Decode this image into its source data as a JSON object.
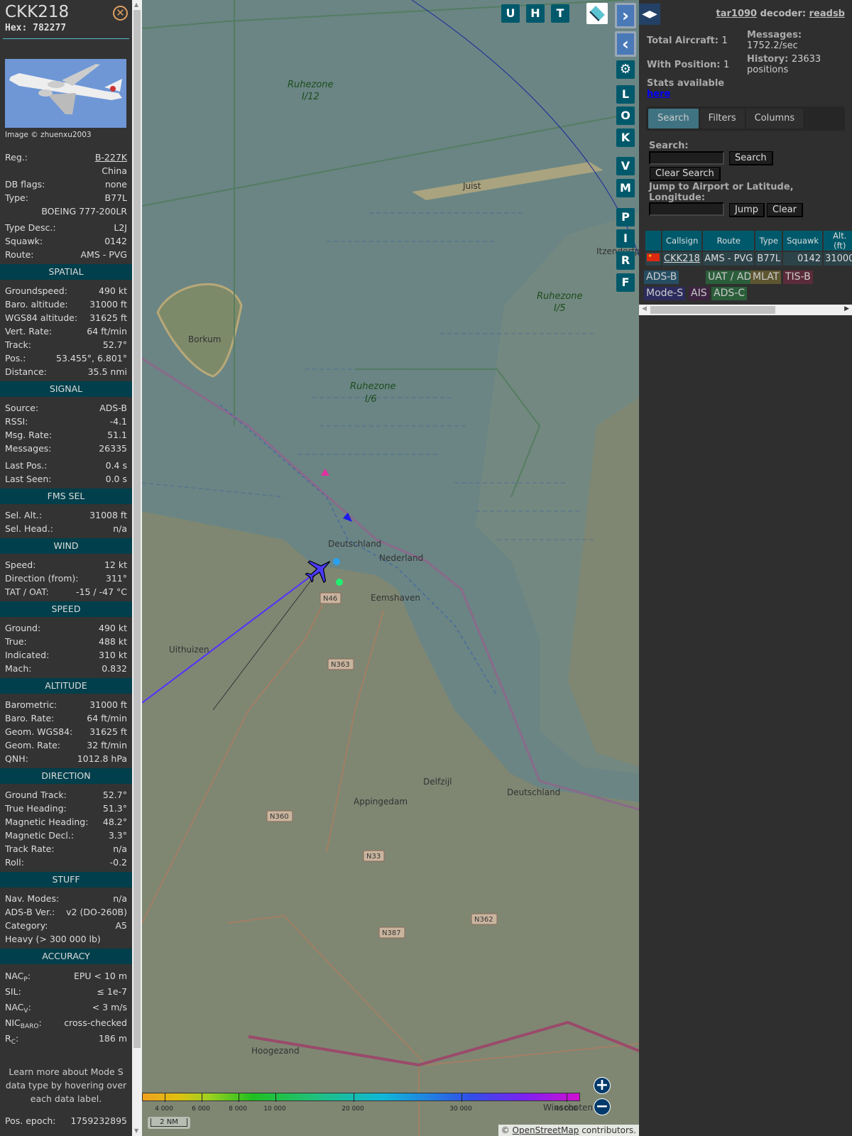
{
  "aircraft": {
    "callsign": "CKK218",
    "hex": "Hex: 782277",
    "image_credit": "Image © zhuenxu2003"
  },
  "info": [
    {
      "label": "Reg.:",
      "value": "B-227K",
      "link": true
    },
    {
      "label": "",
      "value": "China"
    },
    {
      "label": "DB flags:",
      "value": "none"
    },
    {
      "label": "Type:",
      "value": "B77L"
    },
    {
      "label": "",
      "value": "BOEING 777-200LR"
    },
    {
      "label": "Type Desc.:",
      "value": "L2J"
    },
    {
      "label": "Squawk:",
      "value": "0142"
    },
    {
      "label": "Route:",
      "value": "AMS - PVG"
    }
  ],
  "sections": [
    {
      "title": "SPATIAL",
      "rows": [
        [
          "Groundspeed:",
          "490 kt"
        ],
        [
          "Baro. altitude:",
          "31000 ft"
        ],
        [
          "WGS84 altitude:",
          "31625 ft"
        ],
        [
          "Vert. Rate:",
          "64 ft/min"
        ],
        [
          "Track:",
          "52.7°"
        ],
        [
          "Pos.:",
          "53.455°, 6.801°"
        ],
        [
          "Distance:",
          "35.5 nmi"
        ]
      ]
    },
    {
      "title": "SIGNAL",
      "rows": [
        [
          "Source:",
          "ADS-B"
        ],
        [
          "RSSI:",
          "-4.1"
        ],
        [
          "Msg. Rate:",
          "51.1"
        ],
        [
          "Messages:",
          "26335"
        ],
        [
          "Last Pos.:",
          "0.4 s"
        ],
        [
          "Last Seen:",
          "0.0 s"
        ]
      ]
    },
    {
      "title": "FMS SEL",
      "rows": [
        [
          "Sel. Alt.:",
          "31008 ft"
        ],
        [
          "Sel. Head.:",
          "n/a"
        ]
      ]
    },
    {
      "title": "WIND",
      "rows": [
        [
          "Speed:",
          "12 kt"
        ],
        [
          "Direction (from):",
          "311°"
        ],
        [
          "TAT / OAT:",
          "-15 / -47 °C"
        ]
      ]
    },
    {
      "title": "SPEED",
      "rows": [
        [
          "Ground:",
          "490 kt"
        ],
        [
          "True:",
          "488 kt"
        ],
        [
          "Indicated:",
          "310 kt"
        ],
        [
          "Mach:",
          "0.832"
        ]
      ]
    },
    {
      "title": "ALTITUDE",
      "rows": [
        [
          "Barometric:",
          "31000 ft"
        ],
        [
          "Baro. Rate:",
          "64 ft/min"
        ],
        [
          "Geom. WGS84:",
          "31625 ft"
        ],
        [
          "Geom. Rate:",
          "32 ft/min"
        ],
        [
          "QNH:",
          "1012.8 hPa"
        ]
      ]
    },
    {
      "title": "DIRECTION",
      "rows": [
        [
          "Ground Track:",
          "52.7°"
        ],
        [
          "True Heading:",
          "51.3°"
        ],
        [
          "Magnetic Heading:",
          "48.2°"
        ],
        [
          "Magnetic Decl.:",
          "3.3°"
        ],
        [
          "Track Rate:",
          "n/a"
        ],
        [
          "Roll:",
          "-0.2"
        ]
      ]
    },
    {
      "title": "STUFF",
      "rows": [
        [
          "Nav. Modes:",
          "n/a"
        ],
        [
          "ADS-B Ver.:",
          "v2 (DO-260B)"
        ],
        [
          "Category:",
          "A5"
        ]
      ],
      "extra": "Heavy (> 300 000 lb)"
    }
  ],
  "accuracy": {
    "title": "ACCURACY",
    "rows": [
      {
        "label": "NAC",
        "sub": "P",
        "value": "EPU < 10 m"
      },
      {
        "label": "SIL",
        "sub": "",
        "value": "≤ 1e-7"
      },
      {
        "label": "NAC",
        "sub": "V",
        "value": "< 3 m/s"
      },
      {
        "label": "NIC",
        "sub": "BARO",
        "value": "cross-checked"
      },
      {
        "label": "R",
        "sub": "C",
        "value": "186 m"
      }
    ],
    "note": "Learn more about Mode S data type by hovering over each data label.",
    "epoch_label": "Pos. epoch:",
    "epoch_value": "1759232895"
  },
  "map": {
    "buttons_top": [
      "U",
      "H",
      "T"
    ],
    "buttons_side": [
      "L",
      "O",
      "K",
      "V",
      "M",
      "P",
      "I",
      "R",
      "F"
    ],
    "labels": {
      "rz12a": "Ruhezone",
      "rz12b": "I/12",
      "rz6a": "Ruhezone",
      "rz6b": "I/6",
      "rz5a": "Ruhezone",
      "rz5b": "I/5",
      "borkum": "Borkum",
      "juist": "Juist",
      "uithuizen": "Uithuizen",
      "eemshaven": "Eemshaven",
      "delfzijl": "Delfzijl",
      "appingedam": "Appingedam",
      "hoogezand": "Hoogezand",
      "winschoten": "Winschoten",
      "de": "Deutschland",
      "nl": "Nederland",
      "de2": "Deutschland",
      "itzendorf": "Itzendorfplate",
      "n46": "N46",
      "n363": "N363",
      "n360": "N360",
      "n33": "N33",
      "n362": "N362",
      "n387": "N387"
    },
    "legend_labels": [
      "4 000",
      "6 000",
      "8 000",
      "10 000",
      "20 000",
      "30 000",
      "40 000"
    ],
    "scale": "2 NM",
    "attribution_prefix": "© ",
    "attribution_link": "OpenStreetMap",
    "attribution_suffix": " contributors.",
    "zoom_in": "+",
    "zoom_out": "−"
  },
  "right": {
    "toggle": "◀▶",
    "decoder_name": "tar1090",
    "decoder_mid": " decoder: ",
    "decoder_impl": "readsb",
    "total_label": "Total Aircraft:",
    "total": "1",
    "withpos_label": "With Position:",
    "withpos": "1",
    "messages_label": "Messages:",
    "messages": "1752.2/sec",
    "history_label": "History:",
    "history": "23633 positions",
    "stats_label": "Stats available",
    "stats_link": "here",
    "tabs": [
      "Search",
      "Filters",
      "Columns"
    ],
    "search_label": "Search:",
    "search_value": "",
    "search_btn": "Search",
    "clear_search_btn": "Clear Search",
    "jump_label": "Jump to Airport or Latitude, Longitude:",
    "jump_value": "",
    "jump_btn": "Jump",
    "clear_btn": "Clear",
    "table": {
      "headers": [
        "",
        "Callsign",
        "Route",
        "Type",
        "Squawk",
        "Alt. (ft)"
      ],
      "rows": [
        {
          "callsign": "CKK218",
          "route": "AMS - PVG",
          "type": "B77L",
          "squawk": "0142",
          "alt": "31000"
        }
      ]
    },
    "chips": [
      {
        "label": "ADS-B",
        "color": "#264e63"
      },
      {
        "label": "UAT / ADS-R",
        "color": "#2b5e3a"
      },
      {
        "label": "MLAT",
        "color": "#5e5630"
      },
      {
        "label": "TIS-B",
        "color": "#5c2b3a"
      },
      {
        "label": "Mode-S",
        "color": "#2b2b5e"
      },
      {
        "label": "AIS",
        "color": "#3d2440"
      },
      {
        "label": "ADS-C",
        "color": "#2b5e3a"
      }
    ]
  }
}
